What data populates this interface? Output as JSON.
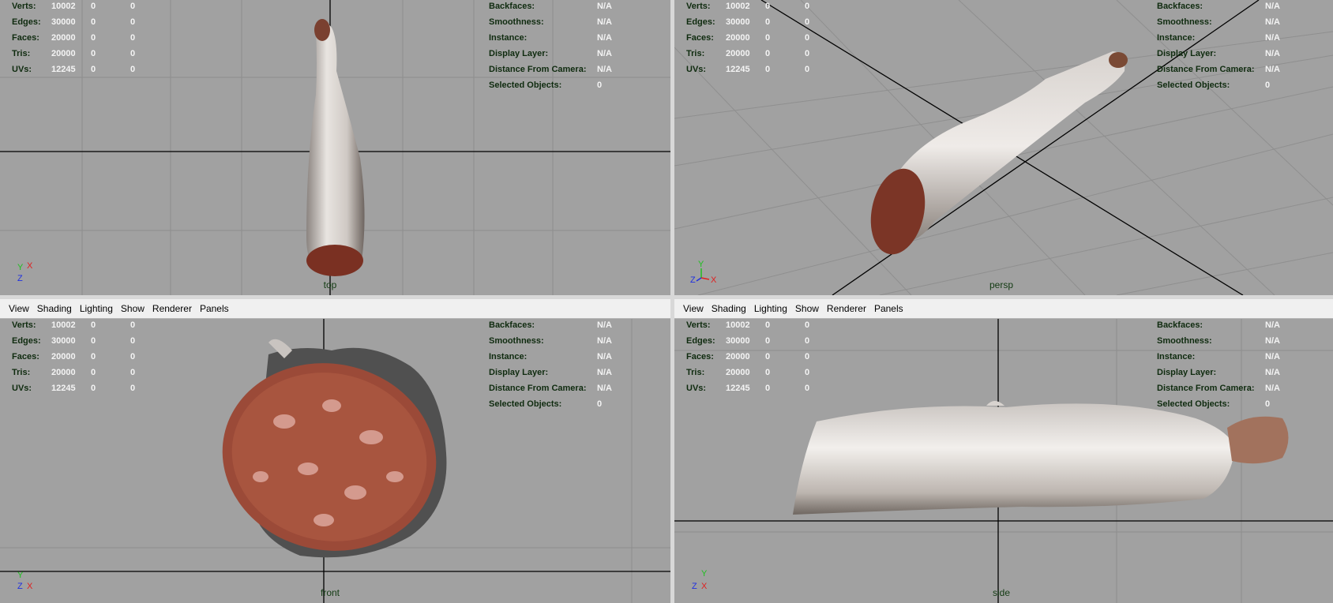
{
  "menu": [
    "View",
    "Shading",
    "Lighting",
    "Show",
    "Renderer",
    "Panels"
  ],
  "hud_left": [
    {
      "label": "Verts:",
      "v1": "10002",
      "v2": "0",
      "v3": "0"
    },
    {
      "label": "Edges:",
      "v1": "30000",
      "v2": "0",
      "v3": "0"
    },
    {
      "label": "Faces:",
      "v1": "20000",
      "v2": "0",
      "v3": "0"
    },
    {
      "label": "Tris:",
      "v1": "20000",
      "v2": "0",
      "v3": "0"
    },
    {
      "label": "UVs:",
      "v1": "12245",
      "v2": "0",
      "v3": "0"
    }
  ],
  "hud_right": [
    {
      "label": "Backfaces:",
      "value": "N/A"
    },
    {
      "label": "Smoothness:",
      "value": "N/A"
    },
    {
      "label": "Instance:",
      "value": "N/A"
    },
    {
      "label": "Display Layer:",
      "value": "N/A"
    },
    {
      "label": "Distance From Camera:",
      "value": "N/A"
    },
    {
      "label": "Selected Objects:",
      "value": "0"
    }
  ],
  "panels": {
    "top": {
      "camera": "top"
    },
    "persp": {
      "camera": "persp"
    },
    "front": {
      "camera": "front"
    },
    "side": {
      "camera": "side"
    }
  },
  "axis_labels": {
    "x": "X",
    "y": "Y",
    "z": "Z"
  },
  "colors": {
    "viewport_bg": "#a1a1a1",
    "grid_line": "#8a8a8a",
    "axis_line": "#000000",
    "hud_label": "#0f2b0f",
    "hud_value": "#f4f4f4",
    "axis_x": "#e02020",
    "axis_y": "#20c020",
    "axis_z": "#2030e0"
  }
}
